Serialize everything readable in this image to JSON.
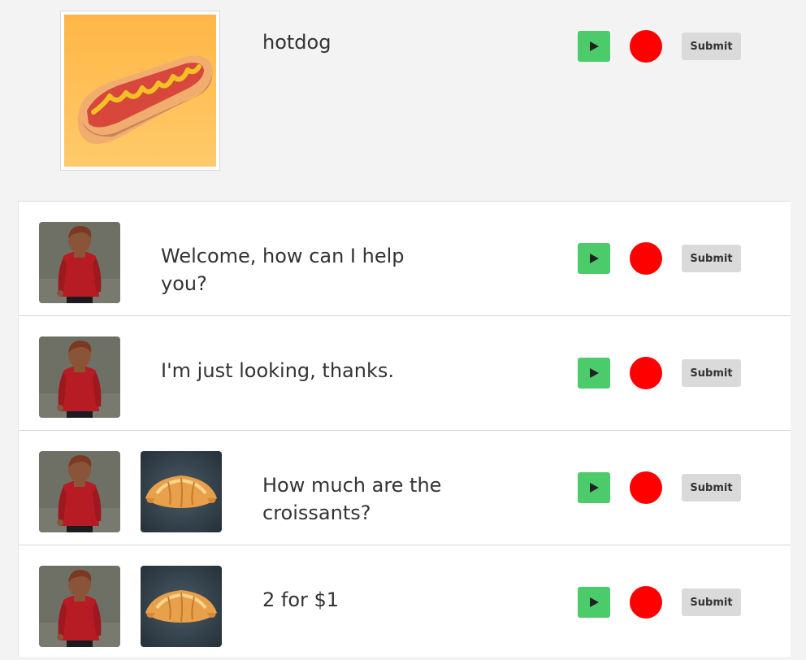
{
  "top": {
    "picture_icon": "hotdog-image",
    "word": "hotdog"
  },
  "controls": {
    "play_icon": "play-icon",
    "record_icon": "record-icon",
    "submit_label": "Submit"
  },
  "colors": {
    "play": "#4ccb6b",
    "record": "#ff0000",
    "submit": "#dadada",
    "background": "#f3f3f3"
  },
  "dialogue": [
    {
      "avatar_icon": "person-avatar",
      "line": "Welcome, how can I help you?"
    },
    {
      "avatar_icon": "person-avatar",
      "line": "I'm just looking, thanks."
    },
    {
      "avatar_icon": "person-avatar",
      "picture_icon": "croissant-image",
      "line": "How much are the croissants?"
    },
    {
      "avatar_icon": "person-avatar",
      "picture_icon": "croissant-image",
      "line": "2 for $1"
    }
  ]
}
